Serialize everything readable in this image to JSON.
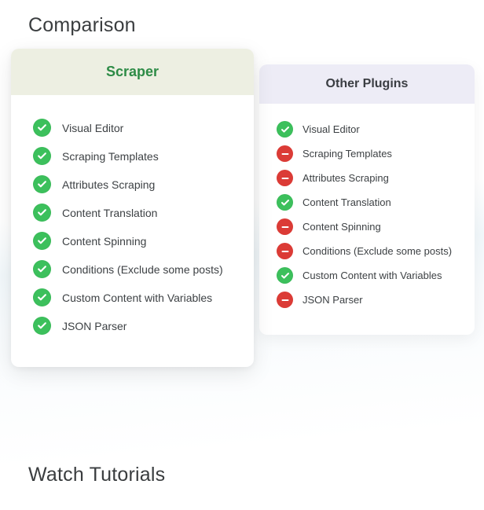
{
  "headings": {
    "comparison": "Comparison",
    "tutorials": "Watch Tutorials"
  },
  "columns": {
    "primary": {
      "title": "Scraper"
    },
    "secondary": {
      "title": "Other Plugins"
    }
  },
  "features": {
    "visual_editor": "Visual Editor",
    "scraping_templates": "Scraping Templates",
    "attributes_scraping": "Attributes Scraping",
    "content_translation": "Content Translation",
    "content_spinning": "Content Spinning",
    "conditions": "Conditions (Exclude some posts)",
    "custom_content": "Custom Content with Variables",
    "json_parser": "JSON Parser"
  }
}
